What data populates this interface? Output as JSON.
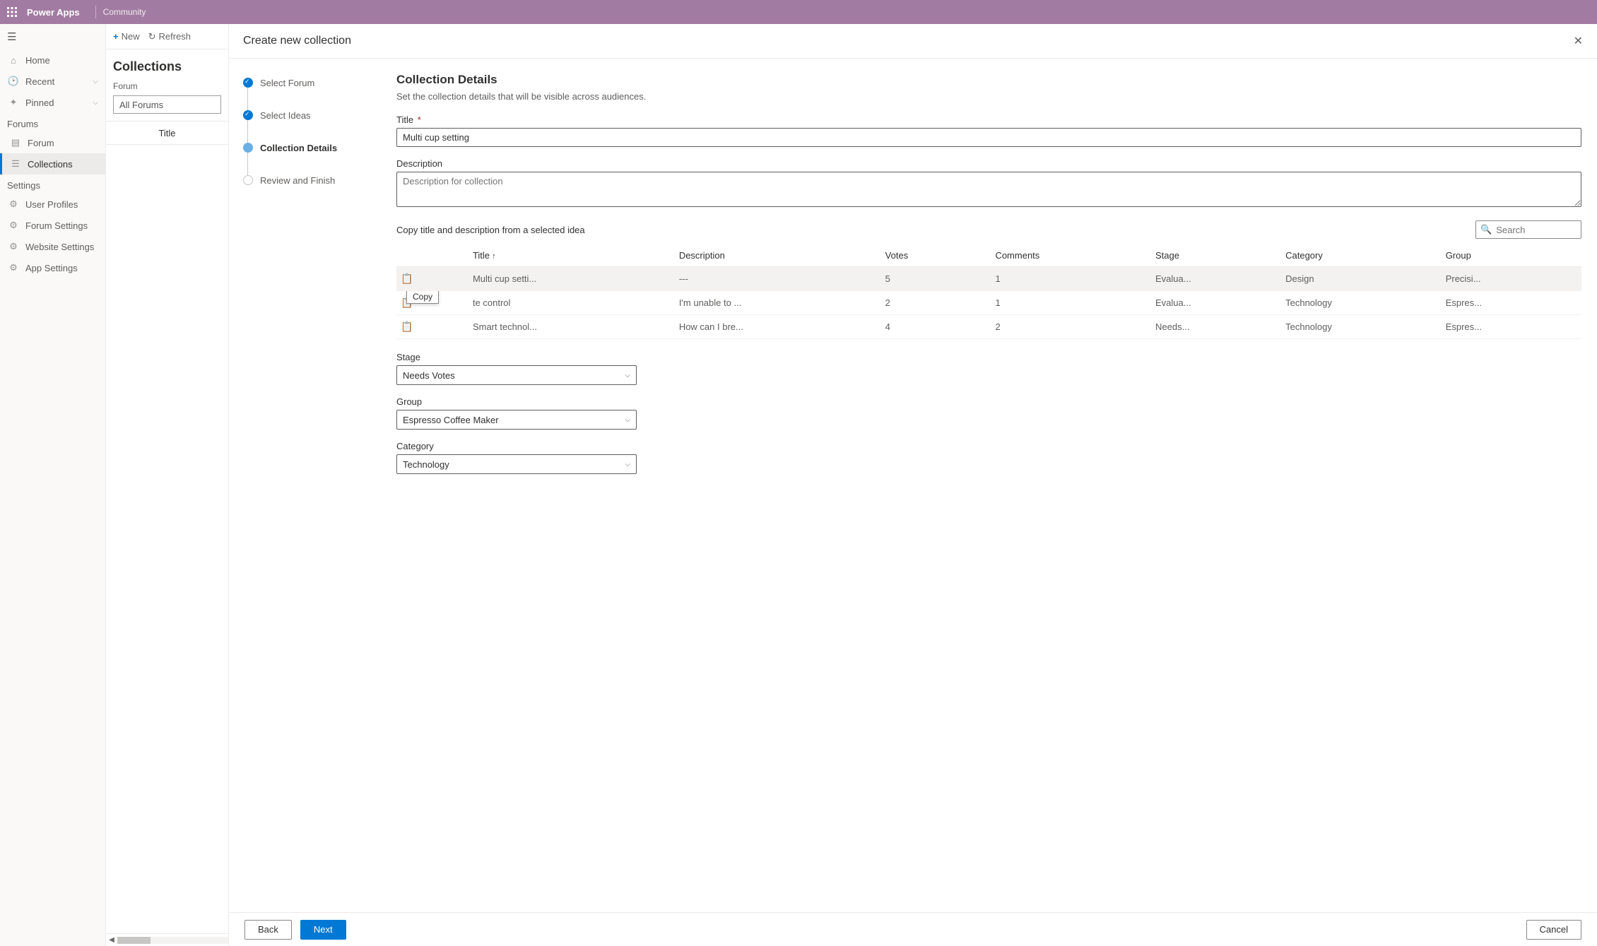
{
  "topbar": {
    "brand": "Power Apps",
    "sub": "Community"
  },
  "leftnav": {
    "home": "Home",
    "recent": "Recent",
    "pinned": "Pinned",
    "forums_section": "Forums",
    "forum": "Forum",
    "collections": "Collections",
    "settings_section": "Settings",
    "user_profiles": "User Profiles",
    "forum_settings": "Forum Settings",
    "website_settings": "Website Settings",
    "app_settings": "App Settings"
  },
  "midpane": {
    "new": "New",
    "refresh": "Refresh",
    "heading": "Collections",
    "forum_label": "Forum",
    "forum_value": "All Forums",
    "title_head": "Title"
  },
  "panel": {
    "title": "Create new collection",
    "steps": {
      "select_forum": "Select Forum",
      "select_ideas": "Select Ideas",
      "collection_details": "Collection Details",
      "review_finish": "Review and Finish"
    },
    "details_heading": "Collection Details",
    "details_desc": "Set the collection details that will be visible across audiences.",
    "title_label": "Title",
    "title_value": "Multi cup setting",
    "description_label": "Description",
    "description_placeholder": "Description for collection",
    "copy_label": "Copy title and description from a selected idea",
    "search_placeholder": "Search",
    "table_headers": {
      "title": "Title",
      "description": "Description",
      "votes": "Votes",
      "comments": "Comments",
      "stage": "Stage",
      "category": "Category",
      "group": "Group"
    },
    "ideas": [
      {
        "title": "Multi cup setti...",
        "description": "---",
        "votes": "5",
        "comments": "1",
        "stage": "Evalua...",
        "category": "Design",
        "group": "Precisi..."
      },
      {
        "title": "te control",
        "description": "I'm unable to ...",
        "votes": "2",
        "comments": "1",
        "stage": "Evalua...",
        "category": "Technology",
        "group": "Espres..."
      },
      {
        "title": "Smart technol...",
        "description": "How can I bre...",
        "votes": "4",
        "comments": "2",
        "stage": "Needs...",
        "category": "Technology",
        "group": "Espres..."
      }
    ],
    "copy_tooltip": "Copy",
    "stage_label": "Stage",
    "stage_value": "Needs Votes",
    "group_label": "Group",
    "group_value": "Espresso Coffee Maker",
    "category_label": "Category",
    "category_value": "Technology",
    "footer": {
      "back": "Back",
      "next": "Next",
      "cancel": "Cancel"
    }
  }
}
